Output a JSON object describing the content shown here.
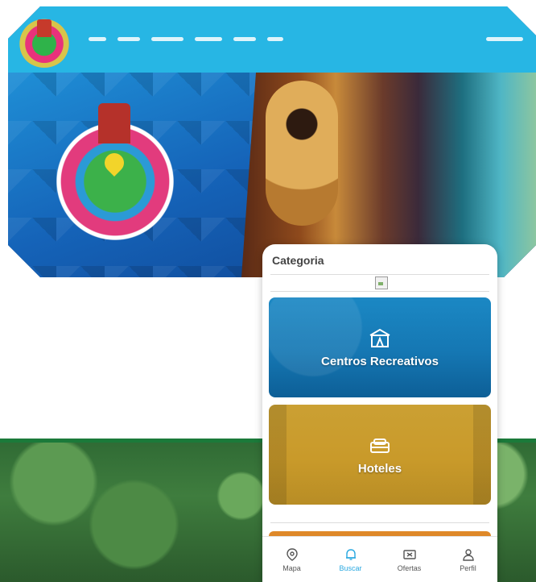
{
  "website": {
    "nav_items_count": 6
  },
  "app": {
    "section_title": "Categoria",
    "categories": [
      {
        "label": "Centros Recreativos",
        "icon": "tent-icon"
      },
      {
        "label": "Hoteles",
        "icon": "bed-icon"
      }
    ],
    "tabs": [
      {
        "label": "Mapa",
        "icon": "map-pin-icon",
        "active": false
      },
      {
        "label": "Buscar",
        "icon": "bell-icon",
        "active": true
      },
      {
        "label": "Ofertas",
        "icon": "ticket-icon",
        "active": false
      },
      {
        "label": "Perfil",
        "icon": "user-icon",
        "active": false
      }
    ],
    "colors": {
      "accent": "#29a8e0",
      "card_blue": "#1577b3",
      "card_gold": "#c99a2a",
      "card_orange": "#d27a1f"
    }
  }
}
